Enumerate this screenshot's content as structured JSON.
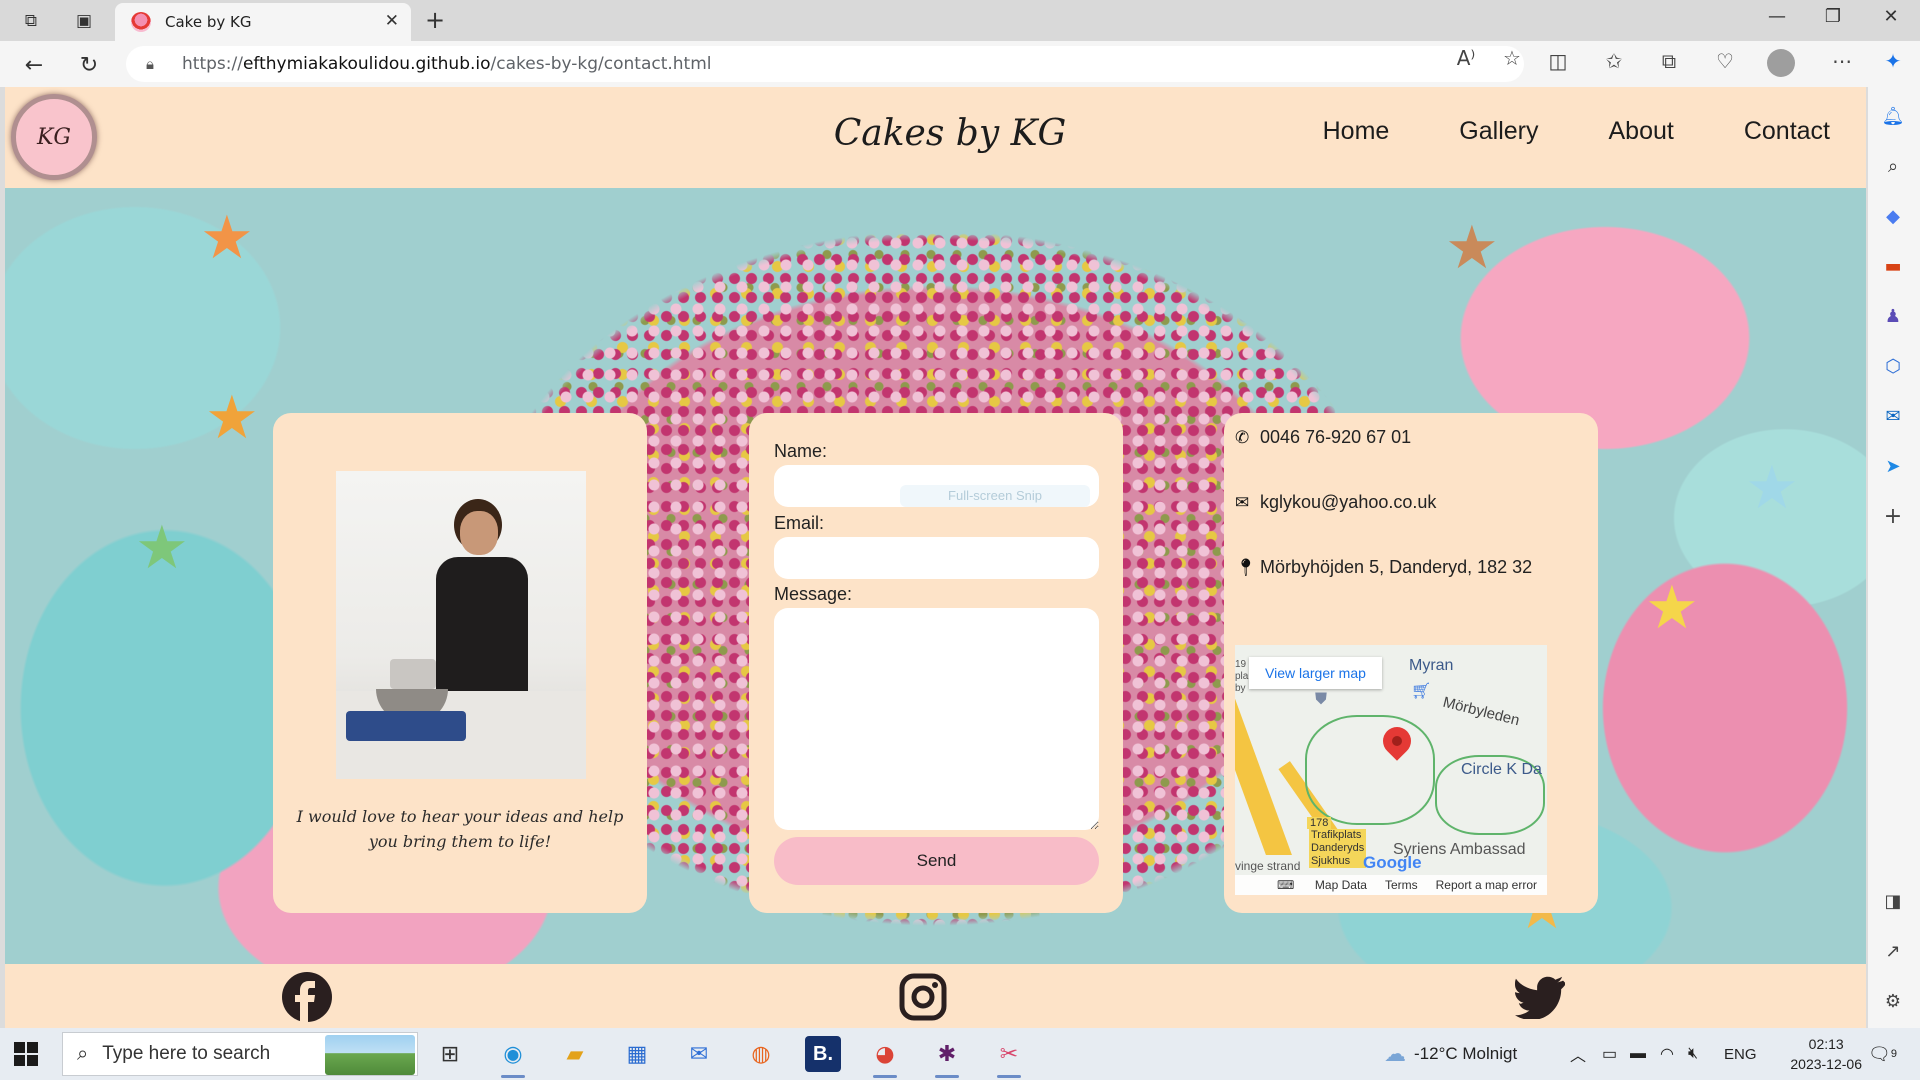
{
  "browser": {
    "tab_title": "Cake by KG",
    "url_prefix": "https://",
    "url_host": "efthymiakakoulidou.github.io",
    "url_path": "/cakes-by-kg/contact.html"
  },
  "site": {
    "logo_text": "KG",
    "title": "Cakes by KG",
    "nav": [
      "Home",
      "Gallery",
      "About",
      "Contact"
    ]
  },
  "about_card": {
    "quote": "I would love to hear your ideas and help you bring them to life!"
  },
  "contact_form": {
    "name_label": "Name:",
    "email_label": "Email:",
    "message_label": "Message:",
    "send_label": "Send",
    "overlay_ghost_text": "Full-screen Snip"
  },
  "contact_info": {
    "phone": "0046 76-920 67 01",
    "email": "kglykou@yahoo.co.uk",
    "address": "Mörbyhöjden 5, Danderyd, 182 32"
  },
  "map": {
    "view_larger": "View larger map",
    "labels": {
      "myran": "Myran",
      "morbyleden": "Mörbyleden",
      "circle_k": "Circle K Da",
      "ambassad": "Syriens Ambassad",
      "trafikplats": "Trafikplats",
      "danderyds": "Danderyds",
      "sjukhus": "Sjukhus",
      "strand": "vinge strand",
      "road_num": "178",
      "edge_top": "19",
      "edge_mid1": "pla",
      "edge_mid2": "by",
      "google": "Google"
    },
    "footer": [
      "Map Data",
      "Terms",
      "Report a map error"
    ]
  },
  "footer_social": [
    "facebook-icon",
    "instagram-icon",
    "twitter-icon"
  ],
  "taskbar": {
    "search_placeholder": "Type here to search",
    "weather": "-12°C  Molnigt",
    "lang": "ENG",
    "time": "02:13",
    "date": "2023-12-06",
    "notif_count": "9"
  }
}
